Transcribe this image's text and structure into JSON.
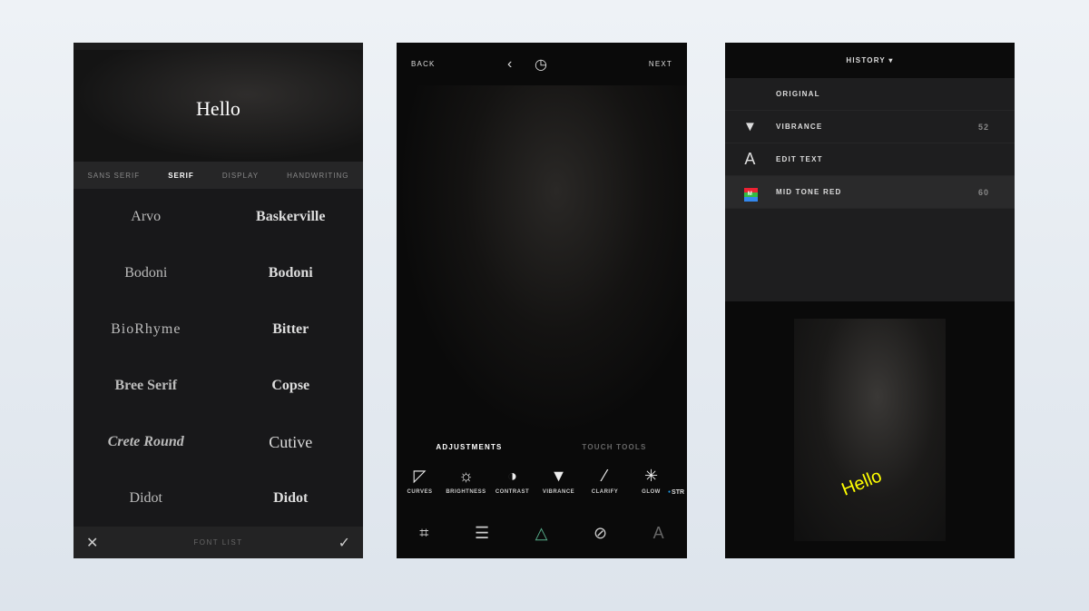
{
  "font_panel": {
    "preview_text": "Hello",
    "tabs": [
      {
        "label": "SANS SERIF"
      },
      {
        "label": "SERIF",
        "active": true
      },
      {
        "label": "DISPLAY"
      },
      {
        "label": "HANDWRITING"
      }
    ],
    "fonts": [
      "Arvo",
      "Baskerville",
      "Bodoni",
      "Bodoni",
      "BioRhyme",
      "Bitter",
      "Bree Serif",
      "Copse",
      "Crete Round",
      "Cutive",
      "Didot",
      "Didot"
    ],
    "bottom": {
      "close_icon": "close-icon",
      "title": "FONT LIST",
      "confirm_icon": "check-icon"
    }
  },
  "editor_panel": {
    "back": "BACK",
    "next": "NEXT",
    "tabs": [
      {
        "label": "ADJUSTMENTS",
        "active": true
      },
      {
        "label": "TOUCH TOOLS"
      }
    ],
    "tools": [
      {
        "label": "CURVES",
        "icon": "curves-icon"
      },
      {
        "label": "BRIGHTNESS",
        "icon": "sun-icon"
      },
      {
        "label": "CONTRAST",
        "icon": "contrast-icon"
      },
      {
        "label": "VIBRANCE",
        "icon": "vibrance-icon"
      },
      {
        "label": "CLARIFY",
        "icon": "wand-icon"
      },
      {
        "label": "GLOW",
        "icon": "glow-icon"
      },
      {
        "label": "STR"
      }
    ],
    "bottom_icons": [
      "crop-icon",
      "adjust-icon",
      "filters-icon",
      "blend-icon",
      "text-icon"
    ],
    "accent": "#1e9be8"
  },
  "history_panel": {
    "title": "HISTORY",
    "rows": [
      {
        "label": "ORIGINAL",
        "value": ""
      },
      {
        "label": "VIBRANCE",
        "value": "52"
      },
      {
        "label": "EDIT TEXT",
        "value": ""
      },
      {
        "label": "MID TONE RED",
        "value": "60",
        "badge": "M"
      }
    ],
    "overlay_text": "Hello"
  }
}
